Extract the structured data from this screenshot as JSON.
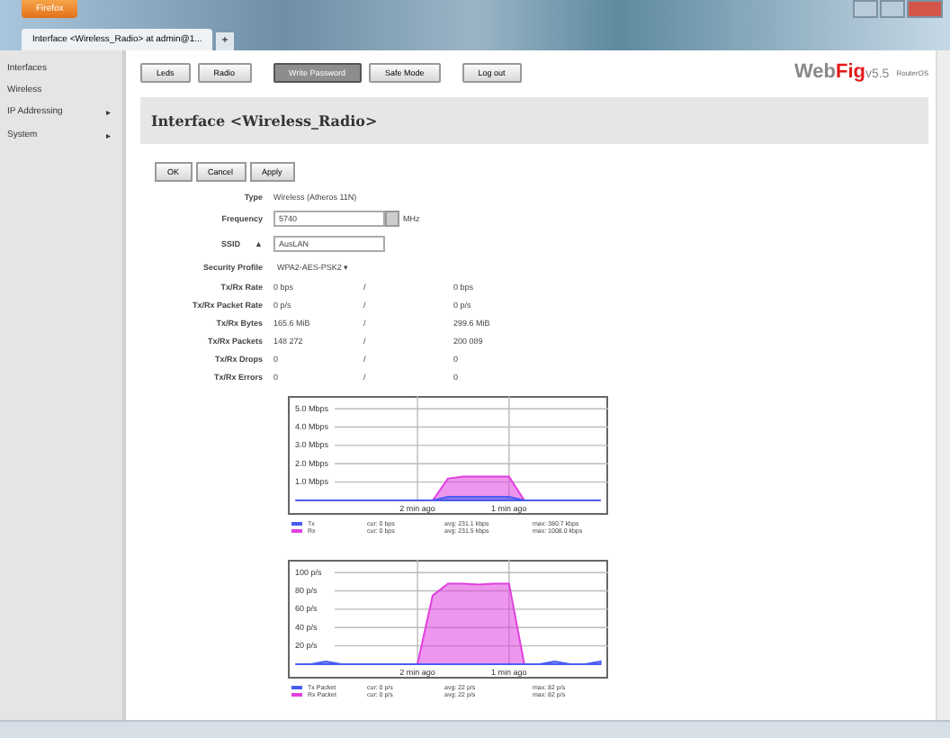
{
  "browser": {
    "menu_button": "Firefox",
    "tab_title": "Interface <Wireless_Radio> at admin@1...",
    "new_tab": "+"
  },
  "sidebar": {
    "items": [
      {
        "label": "Interfaces"
      },
      {
        "label": "Wireless"
      },
      {
        "label": "IP Addressing",
        "arrow": "▸"
      },
      {
        "label": "System",
        "arrow": "▸"
      }
    ]
  },
  "toolbar": {
    "buttons": [
      {
        "label": "Leds",
        "selected": false
      },
      {
        "label": "Radio",
        "selected": false
      },
      {
        "label": "Write Password",
        "selected": true
      },
      {
        "label": "Safe Mode",
        "selected": false
      },
      {
        "label": "Log out",
        "selected": false
      }
    ],
    "logo": {
      "web": "Web",
      "fig": "Fig",
      "version": "v5.5",
      "board": "RouterOS"
    }
  },
  "page_title": "Interface <Wireless_Radio>",
  "form_buttons": [
    "OK",
    "Cancel",
    "Apply"
  ],
  "fields": [
    {
      "kind": "text",
      "label": "Type",
      "value": "Wireless (Atheros 11N)"
    },
    {
      "kind": "combo",
      "label": "Frequency",
      "value": "5740",
      "unit": "MHz"
    },
    {
      "kind": "input",
      "label": "SSID",
      "value": "AusLAN",
      "toggle": "▲"
    },
    {
      "kind": "select",
      "label": "Security Profile",
      "value": "WPA2-AES-PSK2",
      "caret": "▾"
    }
  ],
  "stats": [
    {
      "label": "Tx/Rx Rate",
      "tx": "0 bps",
      "rx": "0 bps"
    },
    {
      "label": "Tx/Rx Packet Rate",
      "tx": "0 p/s",
      "rx": "0 p/s"
    },
    {
      "label": "Tx/Rx Bytes",
      "tx": "165.6 MiB",
      "rx": "299.6 MiB"
    },
    {
      "label": "Tx/Rx Packets",
      "tx": "148 272",
      "rx": "200 089"
    },
    {
      "label": "Tx/Rx Drops",
      "tx": "0",
      "rx": "0"
    },
    {
      "label": "Tx/Rx Errors",
      "tx": "0",
      "rx": "0"
    }
  ],
  "separator": "/",
  "charts": [
    {
      "chart_data": {
        "type": "area",
        "categories": [
          null,
          null,
          null,
          null,
          null,
          null,
          null,
          null,
          "2 min ago",
          null,
          null,
          null,
          null,
          null,
          "1 min ago",
          null,
          null,
          null,
          null,
          null,
          null
        ],
        "ylim": [
          0,
          5.5
        ],
        "yticks": [
          {
            "value": 1,
            "label": "1.0 Mbps"
          },
          {
            "value": 2,
            "label": "2.0 Mbps"
          },
          {
            "value": 3,
            "label": "3.0 Mbps"
          },
          {
            "value": 4,
            "label": "4.0 Mbps"
          },
          {
            "value": 5,
            "label": "5.0 Mbps"
          }
        ],
        "grid": true,
        "series": [
          {
            "name": "Tx",
            "color": "#4a5cf0",
            "values": [
              0,
              0,
              0,
              0,
              0,
              0,
              0,
              0,
              0,
              0,
              0.2,
              0.2,
              0.2,
              0.2,
              0.2,
              0,
              0,
              0,
              0,
              0,
              0
            ]
          },
          {
            "name": "Rx",
            "color": "#e040e0",
            "values": [
              0,
              0,
              0,
              0,
              0,
              0,
              0,
              0,
              0,
              0,
              1.2,
              1.3,
              1.3,
              1.3,
              1.3,
              0,
              0,
              0,
              0,
              0,
              0
            ]
          }
        ]
      },
      "legend": [
        {
          "cur": "cur: 0 bps",
          "avg": "avg: 231.1 kbps",
          "max": "max: 380.7 kbps"
        },
        {
          "cur": "cur: 0 bps",
          "avg": "avg: 231.5 kbps",
          "max": "max: 1008.0 kbps"
        }
      ]
    },
    {
      "chart_data": {
        "type": "area",
        "categories": [
          null,
          null,
          null,
          null,
          null,
          null,
          null,
          null,
          "2 min ago",
          null,
          null,
          null,
          null,
          null,
          "1 min ago",
          null,
          null,
          null,
          null,
          null,
          null
        ],
        "ylim": [
          0,
          110
        ],
        "yticks": [
          {
            "value": 20,
            "label": "20 p/s"
          },
          {
            "value": 40,
            "label": "40 p/s"
          },
          {
            "value": 60,
            "label": "60 p/s"
          },
          {
            "value": 80,
            "label": "80 p/s"
          },
          {
            "value": 100,
            "label": "100 p/s"
          }
        ],
        "grid": true,
        "series": [
          {
            "name": "Tx Packet",
            "color": "#4a5cf0",
            "values": [
              0,
              0,
              3,
              0,
              0,
              0,
              0,
              0,
              0,
              0,
              0,
              0,
              0,
              0,
              0,
              0,
              0,
              3,
              0,
              0,
              3
            ]
          },
          {
            "name": "Rx Packet",
            "color": "#e040e0",
            "values": [
              0,
              0,
              0,
              0,
              0,
              0,
              0,
              0,
              0,
              75,
              88,
              88,
              87,
              88,
              88,
              0,
              0,
              0,
              0,
              0,
              0
            ]
          }
        ]
      },
      "legend": [
        {
          "cur": "cur: 0 p/s",
          "avg": "avg: 22 p/s",
          "max": "max: 82 p/s"
        },
        {
          "cur": "cur: 0 p/s",
          "avg": "avg: 22 p/s",
          "max": "max: 82 p/s"
        }
      ]
    }
  ]
}
